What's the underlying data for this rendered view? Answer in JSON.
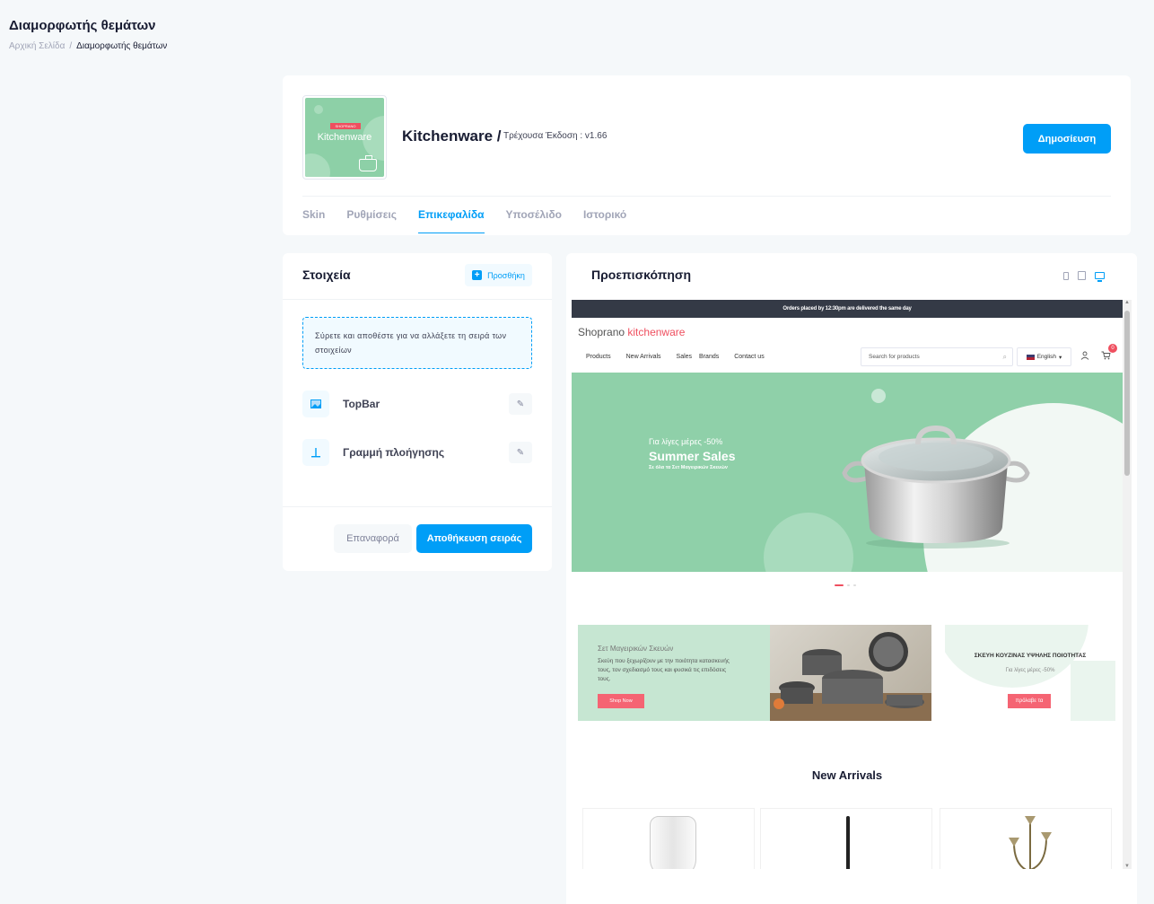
{
  "page": {
    "title": "Διαμορφωτής θεμάτων",
    "breadcrumb": {
      "home": "Αρχική Σελίδα",
      "separator": "/",
      "current": "Διαμορφωτής θεμάτων"
    }
  },
  "theme": {
    "thumb_tag": "SHOPRANO",
    "thumb_name": "Kitchenware",
    "name": "Kitchenware /",
    "version_label": "Τρέχουσα Έκδοση : v1.66",
    "publish_label": "Δημοσίευση"
  },
  "tabs": [
    {
      "label": "Skin",
      "active": false
    },
    {
      "label": "Ρυθμίσεις",
      "active": false
    },
    {
      "label": "Επικεφαλίδα",
      "active": true
    },
    {
      "label": "Υποσέλιδο",
      "active": false
    },
    {
      "label": "Ιστορικό",
      "active": false
    }
  ],
  "elements": {
    "title": "Στοιχεία",
    "add_label": "Προσθήκη",
    "drop_hint": "Σύρετε και αποθέστε για να αλλάξετε τη σειρά των στοιχείων",
    "items": [
      {
        "label": "TopBar",
        "icon": "image-icon"
      },
      {
        "label": "Γραμμή πλοήγησης",
        "icon": "navbar-icon"
      }
    ],
    "reset_label": "Επαναφορά",
    "save_label": "Αποθήκευση σειράς"
  },
  "preview": {
    "title": "Προεπισκόπηση",
    "devices": [
      "mobile",
      "tablet",
      "desktop"
    ],
    "active_device": "desktop",
    "site": {
      "topbar_text": "Orders placed by 12:30pm are delivered the same day",
      "logo_main": "Shoprano ",
      "logo_accent": "kitchenware",
      "nav": [
        "Products",
        "New Arrivals",
        "Sales",
        "Brands",
        "Contact us"
      ],
      "search_placeholder": "Search for products",
      "language": "English",
      "cart_count": "0",
      "hero": {
        "kicker": "Για λίγες μέρες -50%",
        "title": "Summer Sales",
        "subtitle": "Σε όλα τα Σετ Μαγειρικών Σκευών"
      },
      "slider_active_index": 0,
      "promo1": {
        "title": "Σετ Μαγειρικών Σκευών",
        "description": "Σκεύη που ξεχωρίζουν με την ποιότητα κατασκευής τους, τον σχεδιασμό τους και φυσικά τις επιδόσεις τους.",
        "button": "Shop Now"
      },
      "promo2": {
        "title": "ΣΚΕΥΗ ΚΟΥΖΙΝΑΣ ΥΨΗΛΗΣ ΠΟΙΟΤΗΤΑΣ",
        "subtitle": "Για λίγες μέρες -50%",
        "button": "πρόλαβε τα"
      },
      "arrivals_title": "New Arrivals"
    }
  },
  "colors": {
    "primary": "#009ef7",
    "accent": "#ef4f5f",
    "mint": "#8fd0a9",
    "topbar": "#343a46"
  }
}
